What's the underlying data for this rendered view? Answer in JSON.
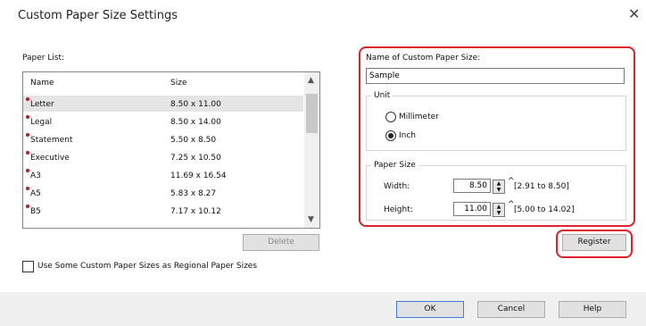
{
  "window": {
    "title": "Custom Paper Size Settings"
  },
  "paper_list": {
    "label": "Paper List:",
    "columns": [
      "Name",
      "Size"
    ],
    "rows": [
      {
        "name": "Letter",
        "size": "8.50 x 11.00",
        "selected": true
      },
      {
        "name": "Legal",
        "size": "8.50 x 14.00"
      },
      {
        "name": "Statement",
        "size": "5.50 x 8.50"
      },
      {
        "name": "Executive",
        "size": "7.25 x 10.50"
      },
      {
        "name": "A3",
        "size": "11.69 x 16.54"
      },
      {
        "name": "A5",
        "size": "5.83 x 8.27"
      },
      {
        "name": "B5",
        "size": "7.17 x 10.12"
      }
    ],
    "delete_label": "Delete"
  },
  "regional_option": {
    "label": "Use Some Custom Paper Sizes as Regional Paper Sizes",
    "checked": false
  },
  "custom": {
    "name_label": "Name of Custom Paper Size:",
    "name_value": "Sample",
    "unit_label": "Unit",
    "units": [
      "Millimeter",
      "Inch"
    ],
    "selected_unit": "Inch",
    "paper_size_label": "Paper Size",
    "width_label": "Width:",
    "width_value": "8.50",
    "width_range": "[2.91 to 8.50]",
    "height_label": "Height:",
    "height_value": "11.00",
    "height_range": "[5.00 to 14.02]",
    "register_label": "Register"
  },
  "footer": {
    "ok": "OK",
    "cancel": "Cancel",
    "help": "Help"
  },
  "colors": {
    "highlight": "#e0202a",
    "marker": "#c4161c",
    "selection": "#e5e5e5"
  }
}
